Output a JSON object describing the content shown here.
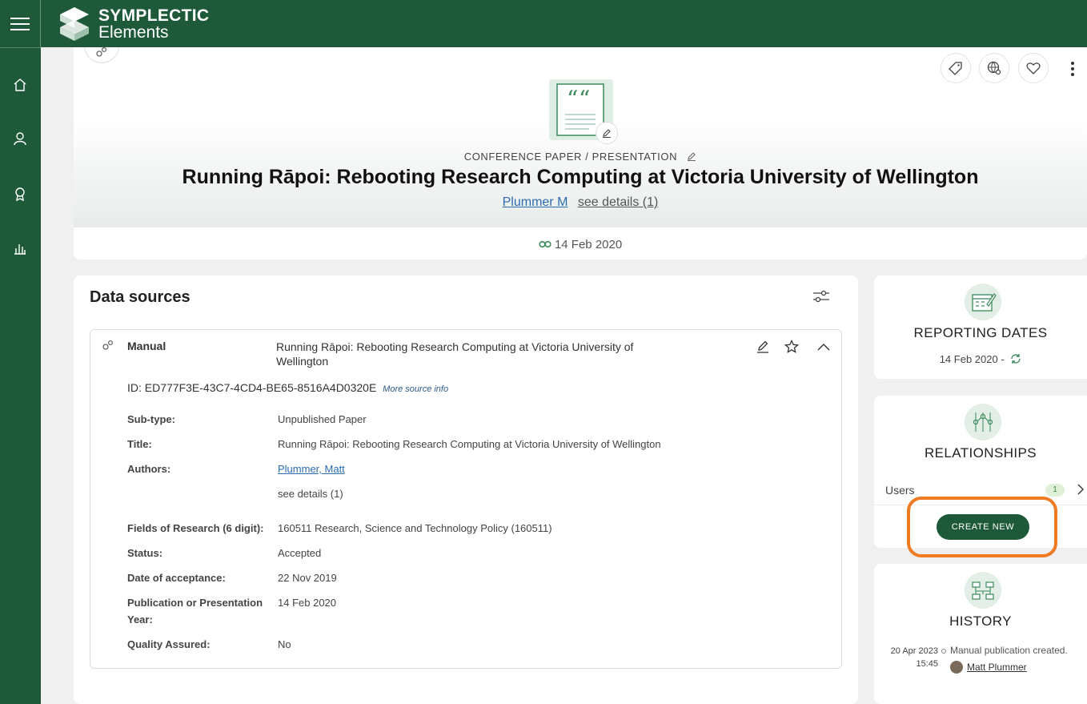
{
  "app": {
    "brand_line1": "SYMPLECTIC",
    "brand_line2": "Elements"
  },
  "sidebar": {
    "items": [
      {
        "icon": "home-icon"
      },
      {
        "icon": "user-icon"
      },
      {
        "icon": "award-icon"
      },
      {
        "icon": "bar-chart-icon"
      }
    ]
  },
  "header": {
    "type_label": "CONFERENCE PAPER / PRESENTATION",
    "title": "Running Rāpoi: Rebooting Research Computing at Victoria University of Wellington",
    "author": "Plummer M",
    "see_details": "see details (1)",
    "date": "14 Feb 2020"
  },
  "data_sources": {
    "heading": "Data sources",
    "source": {
      "name": "Manual",
      "title": "Running Rāpoi: Rebooting Research Computing at Victoria University of Wellington",
      "id": "ID: ED777F3E-43C7-4CD4-BE65-8516A4D0320E",
      "more_info": "More source info",
      "fields": {
        "subtype_label": "Sub-type:",
        "subtype_value": "Unpublished Paper",
        "title_label": "Title:",
        "title_value": "Running Rāpoi: Rebooting Research Computing at Victoria University of Wellington",
        "authors_label": "Authors:",
        "authors_value": "Plummer, Matt",
        "authors_details": "see details (1)",
        "for_label": "Fields of Research (6 digit):",
        "for_value": "160511 Research, Science and Technology Policy (160511)",
        "status_label": "Status:",
        "status_value": "Accepted",
        "doa_label": "Date of acceptance:",
        "doa_value": "22 Nov 2019",
        "pub_label_1": "Publication or Presentation",
        "pub_label_2": "Year:",
        "pub_value": "14 Feb 2020",
        "qa_label": "Quality Assured:",
        "qa_value": "No"
      }
    }
  },
  "reporting_dates": {
    "title": "REPORTING DATES",
    "value": "14 Feb 2020 -"
  },
  "relationships": {
    "title": "RELATIONSHIPS",
    "users_label": "Users",
    "users_count": "1",
    "create_label": "CREATE NEW"
  },
  "history": {
    "title": "HISTORY",
    "date": "20 Apr 2023",
    "time": "15:45",
    "event": "Manual publication created.",
    "user": "Matt Plummer"
  },
  "colors": {
    "brand_green": "#1e5a3a",
    "highlight_orange": "#f07b22",
    "link_blue": "#2b6cb0"
  }
}
